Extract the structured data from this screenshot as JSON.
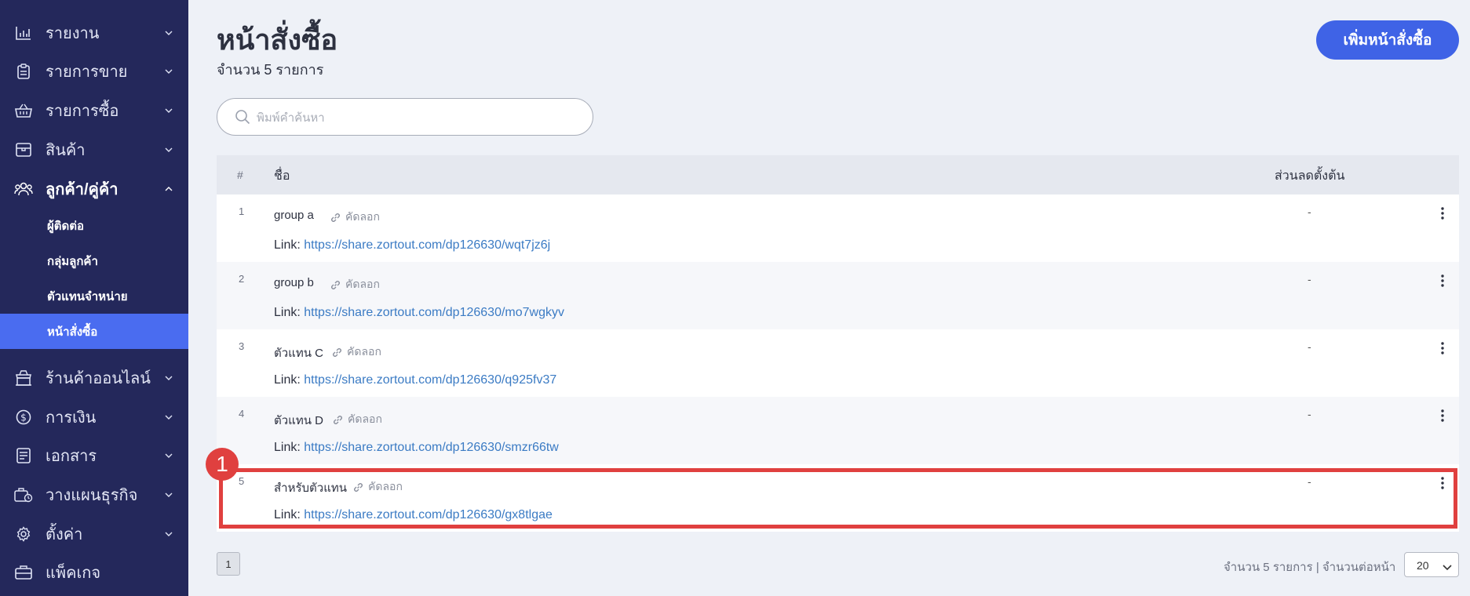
{
  "sidebar": {
    "items": [
      {
        "label": "รายงาน",
        "icon": "bar-chart-icon"
      },
      {
        "label": "รายการขาย",
        "icon": "clipboard-icon"
      },
      {
        "label": "รายการซื้อ",
        "icon": "basket-icon"
      },
      {
        "label": "สินค้า",
        "icon": "box-icon"
      },
      {
        "label": "ลูกค้า/คู่ค้า",
        "icon": "users-icon"
      },
      {
        "label": "ร้านค้าออนไลน์",
        "icon": "store-icon"
      },
      {
        "label": "การเงิน",
        "icon": "coin-icon"
      },
      {
        "label": "เอกสาร",
        "icon": "document-icon"
      },
      {
        "label": "วางแผนธุรกิจ",
        "icon": "briefcase-plan-icon"
      },
      {
        "label": "ตั้งค่า",
        "icon": "gear-icon"
      },
      {
        "label": "แพ็คเกจ",
        "icon": "package-icon"
      }
    ],
    "sub_items": [
      {
        "label": "ผู้ติดต่อ"
      },
      {
        "label": "กลุ่มลูกค้า"
      },
      {
        "label": "ตัวแทนจำหน่าย"
      },
      {
        "label": "หน้าสั่งซื้อ"
      }
    ]
  },
  "header": {
    "title": "หน้าสั่งซื้อ",
    "subtitle": "จำนวน 5 รายการ",
    "add_button": "เพิ่มหน้าสั่งซื้อ"
  },
  "search": {
    "placeholder": "พิมพ์คำค้นหา"
  },
  "table": {
    "columns": {
      "num": "#",
      "name": "ชื่อ",
      "discount": "ส่วนลดตั้งต้น"
    },
    "copy_label": "คัดลอก",
    "link_prefix": "Link:",
    "rows": [
      {
        "num": "1",
        "name": "group a",
        "url": "https://share.zortout.com/dp126630/wqt7jz6j",
        "discount": "-"
      },
      {
        "num": "2",
        "name": "group b",
        "url": "https://share.zortout.com/dp126630/mo7wgkyv",
        "discount": "-"
      },
      {
        "num": "3",
        "name": "ตัวแทน C",
        "url": "https://share.zortout.com/dp126630/q925fv37",
        "discount": "-"
      },
      {
        "num": "4",
        "name": "ตัวแทน D",
        "url": "https://share.zortout.com/dp126630/smzr66tw",
        "discount": "-"
      },
      {
        "num": "5",
        "name": "สำหรับตัวแทน",
        "url": "https://share.zortout.com/dp126630/gx8tlgae",
        "discount": "-"
      }
    ]
  },
  "annotation": {
    "badge": "1",
    "color": "#e0403f"
  },
  "pagination": {
    "current_page": "1",
    "summary": "จำนวน 5 รายการ | จำนวนต่อหน้า",
    "per_page": "20"
  },
  "colors": {
    "sidebar_bg": "#24285b",
    "accent": "#3f63e6",
    "active_item": "#4a6cf0",
    "link": "#3b7bc4"
  }
}
